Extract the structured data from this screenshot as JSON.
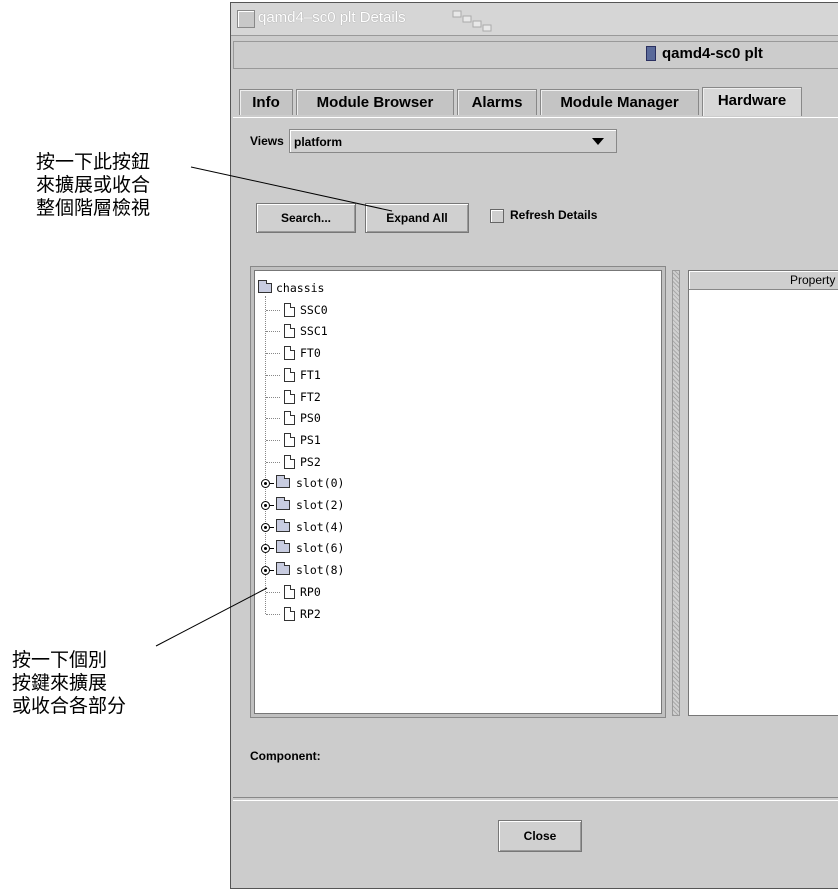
{
  "annotations": {
    "top": "按一下此按鈕\n來擴展或收合\n整個階層檢視",
    "bottom": "按一下個別\n按鍵來擴展\n或收合各部分"
  },
  "window": {
    "title": "qamd4–sc0 plt Details",
    "header_title": "qamd4-sc0 plt"
  },
  "tabs": [
    {
      "label": "Info",
      "active": false
    },
    {
      "label": "Module Browser",
      "active": false
    },
    {
      "label": "Alarms",
      "active": false
    },
    {
      "label": "Module Manager",
      "active": false
    },
    {
      "label": "Hardware",
      "active": true
    }
  ],
  "views": {
    "label": "Views",
    "selected": "platform"
  },
  "toolbar": {
    "search_label": "Search...",
    "expand_all_label": "Expand All",
    "refresh_details_label": "Refresh Details",
    "refresh_details_checked": false
  },
  "tree": {
    "root": "chassis",
    "items": [
      {
        "label": "SSC0",
        "type": "leaf"
      },
      {
        "label": "SSC1",
        "type": "leaf"
      },
      {
        "label": "FT0",
        "type": "leaf"
      },
      {
        "label": "FT1",
        "type": "leaf"
      },
      {
        "label": "FT2",
        "type": "leaf"
      },
      {
        "label": "PS0",
        "type": "leaf"
      },
      {
        "label": "PS1",
        "type": "leaf"
      },
      {
        "label": "PS2",
        "type": "leaf"
      },
      {
        "label": "slot(0)",
        "type": "folder"
      },
      {
        "label": "slot(2)",
        "type": "folder"
      },
      {
        "label": "slot(4)",
        "type": "folder"
      },
      {
        "label": "slot(6)",
        "type": "folder"
      },
      {
        "label": "slot(8)",
        "type": "folder"
      },
      {
        "label": "RP0",
        "type": "leaf"
      },
      {
        "label": "RP2",
        "type": "leaf"
      }
    ]
  },
  "properties": {
    "column_header": "Property"
  },
  "component": {
    "label": "Component:"
  },
  "footer": {
    "close_label": "Close"
  }
}
